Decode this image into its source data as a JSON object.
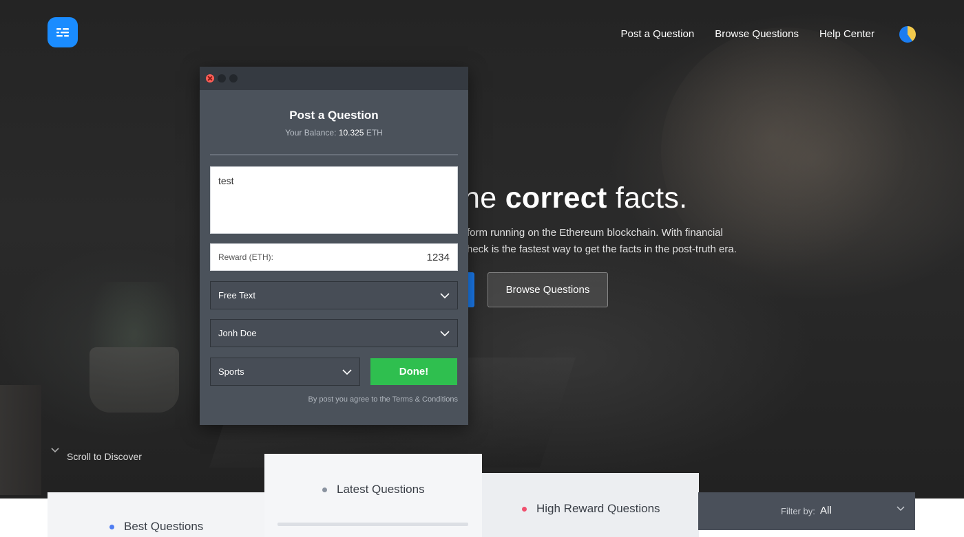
{
  "header": {
    "nav": [
      "Post a Question",
      "Browse Questions",
      "Help Center"
    ]
  },
  "hero": {
    "headline_pre": "he ",
    "headline_bold": "correct",
    "headline_post": " facts.",
    "sub_line1": "form running on the Ethereum blockchain. With financial",
    "sub_line2": "heck is the fastest way to get the facts in the post-truth era.",
    "browse_button": "Browse Questions",
    "scroll_text": "Scroll to Discover"
  },
  "modal": {
    "title": "Post a Question",
    "balance_label": "Your Balance:",
    "balance_value": "10.325",
    "balance_unit": "ETH",
    "question_value": "test",
    "reward_label": "Reward (ETH):",
    "reward_value": "1234",
    "select_type": "Free Text",
    "select_arbitrator": "Jonh Doe",
    "select_category": "Sports",
    "done_button": "Done!",
    "terms": "By post you agree to the Terms & Conditions"
  },
  "tabs": {
    "best": "Best Questions",
    "latest": "Latest Questions",
    "high": "High Reward Questions",
    "filter_label": "Filter by:",
    "filter_value": "All"
  },
  "colors": {
    "brand_blue": "#1a8cff",
    "done_green": "#2fbf4f",
    "best_dot": "#4f7df2",
    "latest_dot": "#8a93a0",
    "high_dot": "#f0506e"
  }
}
